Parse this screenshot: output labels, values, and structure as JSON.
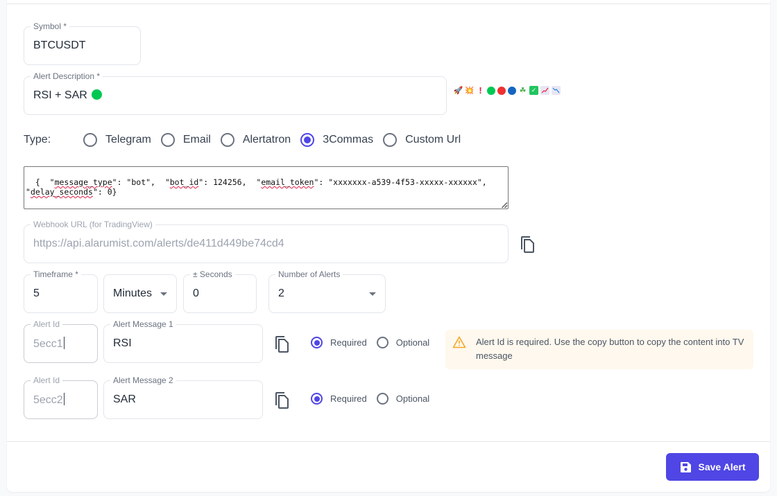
{
  "form": {
    "symbol": {
      "label": "Symbol *",
      "value": "BTCUSDT"
    },
    "description": {
      "label": "Alert Description *",
      "value": "RSI + SAR",
      "status_dot_color": "#00c853"
    },
    "emoji_picker": [
      {
        "name": "rocket",
        "glyph": "🚀"
      },
      {
        "name": "collision",
        "glyph": "💥"
      },
      {
        "name": "exclamation",
        "glyph": "❗"
      },
      {
        "name": "green-circle",
        "color": "#00c853"
      },
      {
        "name": "red-circle",
        "color": "#f03030"
      },
      {
        "name": "blue-circle",
        "color": "#1565c0"
      },
      {
        "name": "shamrock",
        "glyph": "☘"
      },
      {
        "name": "check-box",
        "glyph": "✓"
      },
      {
        "name": "chart-increasing",
        "glyph": "📈"
      },
      {
        "name": "chart-decreasing",
        "glyph": "📉"
      }
    ],
    "type": {
      "label": "Type:",
      "options": [
        "Telegram",
        "Email",
        "Alertatron",
        "3Commas",
        "Custom Url"
      ],
      "selected": "3Commas"
    },
    "payload": {
      "parts": [
        {
          "t": "{  \"",
          "sq": false
        },
        {
          "t": "message_type",
          "sq": true
        },
        {
          "t": "\": \"bot\",  \"",
          "sq": false
        },
        {
          "t": "bot_id",
          "sq": true
        },
        {
          "t": "\": 124256,  \"",
          "sq": false
        },
        {
          "t": "email_token",
          "sq": true
        },
        {
          "t": "\": \"xxxxxxx-a539-4f53-xxxxx-xxxxxx\",\n\"",
          "sq": false
        },
        {
          "t": "delay_seconds",
          "sq": true
        },
        {
          "t": "\": 0}",
          "sq": false
        }
      ]
    },
    "webhook": {
      "label": "Webhook URL (for TradingView)",
      "value": "https://api.alarumist.com/alerts/de411d449be74cd4"
    },
    "timeframe": {
      "label": "Timeframe *",
      "value": "5"
    },
    "unit": {
      "value": "Minutes"
    },
    "seconds": {
      "label": "± Seconds",
      "value": "0"
    },
    "num_alerts": {
      "label": "Number of Alerts",
      "value": "2"
    },
    "messages": [
      {
        "id_label": "Alert Id",
        "id_value": "5ecc1",
        "msg_label": "Alert Message 1",
        "msg_value": "RSI",
        "required_label": "Required",
        "optional_label": "Optional",
        "selected": "Required"
      },
      {
        "id_label": "Alert Id",
        "id_value": "5ecc2",
        "msg_label": "Alert Message 2",
        "msg_value": "SAR",
        "required_label": "Required",
        "optional_label": "Optional",
        "selected": "Required"
      }
    ],
    "warning": "Alert Id is required. Use the copy button to copy the content into TV message",
    "save_label": "Save Alert"
  },
  "colors": {
    "accent": "#4f46e5",
    "warning_bg": "#fef8ee",
    "warning_icon": "#f5a623"
  }
}
